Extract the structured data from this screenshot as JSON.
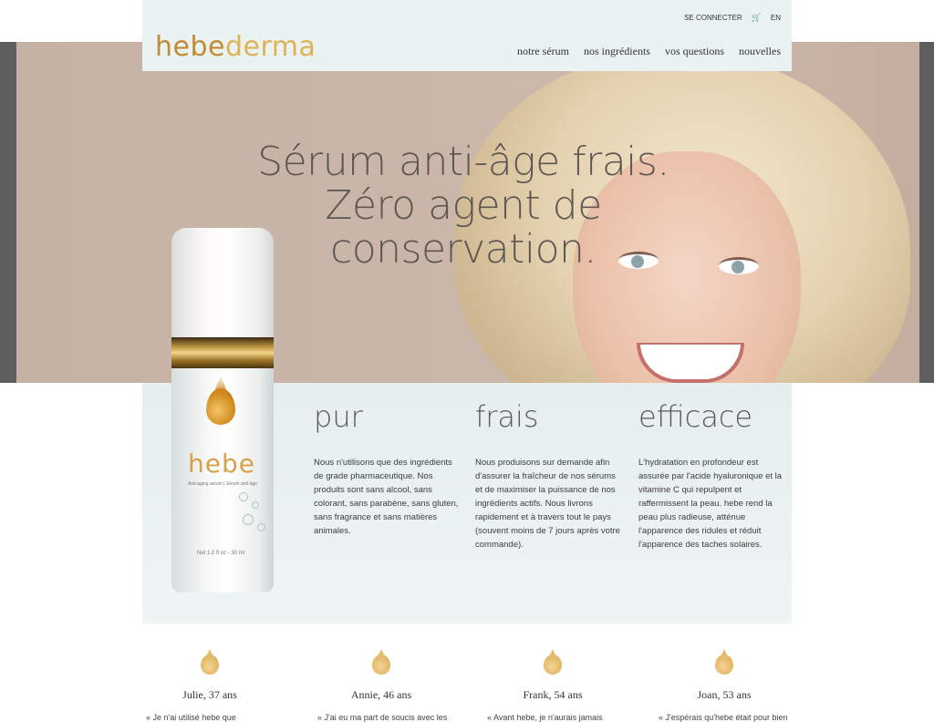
{
  "header": {
    "logo_part1": "hebe",
    "logo_part2": "derma",
    "login": "SE CONNECTER",
    "language": "EN",
    "nav": [
      "notre sérum",
      "nos ingrédients",
      "vos questions",
      "nouvelles"
    ]
  },
  "hero": {
    "title_lines": [
      "Sérum anti-âge frais.",
      "Zéro agent de",
      "conservation."
    ]
  },
  "product": {
    "brand": "hebe",
    "subtitle": "Anti-aging serum | Sérum anti-âge",
    "volume": "Net 1.0 fl oz - 30 ml"
  },
  "features": [
    {
      "title": "pur",
      "text": "Nous n'utilisons que des ingrédients de grade pharmaceutique. Nos produits sont sans alcool, sans colorant, sans parabène, sans gluten, sans fragrance et sans matières animales."
    },
    {
      "title": "frais",
      "text": "Nous produisons sur demande afin d'assurer la fraîcheur de nos sérums et de maximiser la puissance de nos ingrédients actifs. Nous livrons rapidement et à travers tout le pays (souvent moins de 7 jours après votre commande)."
    },
    {
      "title": "efficace",
      "text": "L'hydratation en profondeur est assurée par l'acide hyaluronique et la vitamine C qui repulpent et raffermissent la peau. hebe rend la peau plus radieuse, atténue l'apparence des ridules et réduit l'apparence des taches solaires."
    }
  ],
  "testimonials": [
    {
      "name": "Julie, 37 ans",
      "quote": "« Je n'ai utilisé hebe que"
    },
    {
      "name": "Annie, 46 ans",
      "quote": "« J'ai eu ma part de soucis avec les"
    },
    {
      "name": "Frank, 54 ans",
      "quote": "« Avant hebe, je n'aurais jamais"
    },
    {
      "name": "Joan, 53 ans",
      "quote": "« J'espérais qu'hebe était pour bien"
    }
  ],
  "colors": {
    "accent_gold": "#c28b34",
    "header_bg": "#eaf2f2",
    "hero_bg": "#c9b6a8"
  },
  "icons": [
    "cart-icon",
    "drop-icon"
  ]
}
